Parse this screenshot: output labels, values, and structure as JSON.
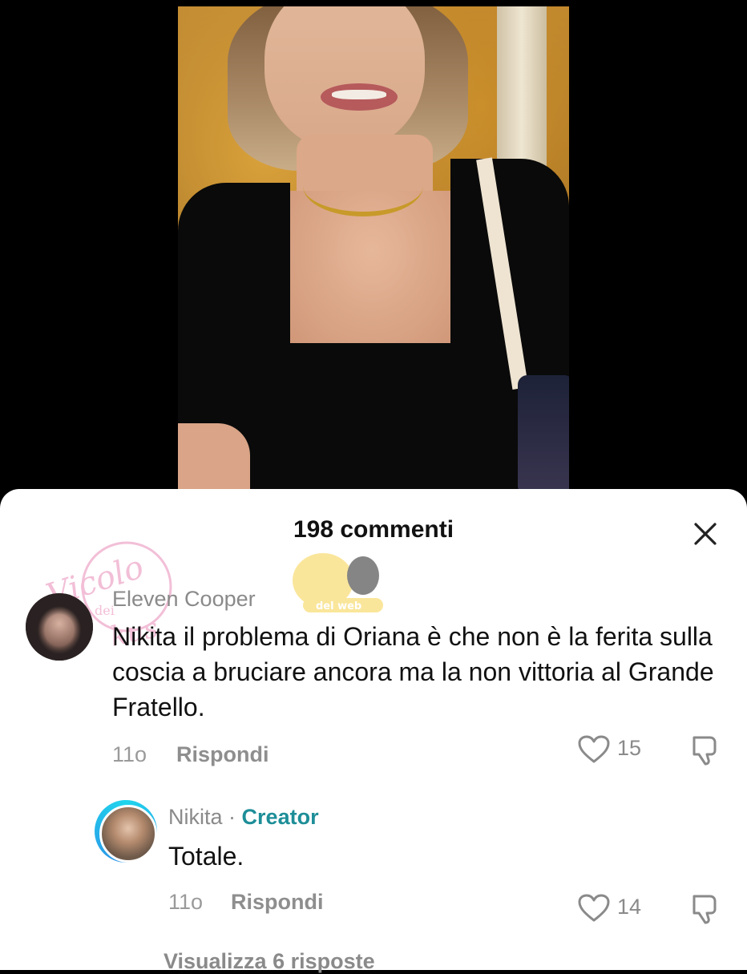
{
  "sheet": {
    "title": "198 commenti",
    "close_icon": "close-icon"
  },
  "watermark": {
    "line1": "Vicolo",
    "line2": "dei",
    "line3": "kus",
    "tag": "del web"
  },
  "comments": [
    {
      "author": "Eleven Cooper",
      "text": "Nikita il problema di Oriana è che non è la ferita sulla coscia a bruciare ancora ma la non vittoria al Grande Fratello.",
      "time": "11o",
      "reply_label": "Rispondi",
      "likes": "15",
      "like_icon": "heart-icon",
      "dislike_icon": "thumbs-down-icon"
    },
    {
      "author": "Nikita",
      "separator": "·",
      "badge": "Creator",
      "text": "Totale.",
      "time": "11o",
      "reply_label": "Rispondi",
      "likes": "14",
      "like_icon": "heart-icon",
      "dislike_icon": "thumbs-down-icon"
    }
  ],
  "more_replies": "Visualizza 6 risposte"
}
